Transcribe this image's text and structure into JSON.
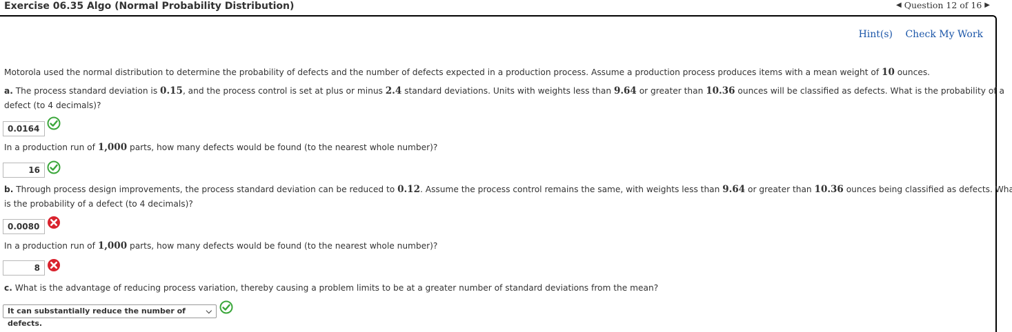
{
  "header": {
    "title": "Exercise 06.35 Algo (Normal Probability Distribution)",
    "question_nav": "Question 12 of 16"
  },
  "links": {
    "hints": "Hint(s)",
    "check": "Check My Work"
  },
  "intro": {
    "t1": "Motorola used the normal distribution to determine the probability of defects and the number of defects expected in a production process. Assume a production process produces items with a mean weight of ",
    "mean": "10",
    "t2": " ounces."
  },
  "part_a": {
    "letter": "a.",
    "t1": " The process standard deviation is ",
    "sd": "0.15",
    "t2": ", and the process control is set at plus or minus ",
    "k": "2.4",
    "t3": " standard deviations. Units with weights less than ",
    "low": "9.64",
    "t4": " or greater than ",
    "high": "10.36",
    "t5": " ounces will be classified as defects. What is the probability of a",
    "line2": "defect (to 4 decimals)?",
    "answer": "0.0164",
    "answer_status": "correct"
  },
  "part_a2": {
    "t1": "In a production run of ",
    "n": "1,000",
    "t2": " parts, how many defects would be found (to the nearest whole number)?",
    "answer": "16",
    "answer_status": "correct"
  },
  "part_b": {
    "letter": "b.",
    "t1": " Through process design improvements, the process standard deviation can be reduced to ",
    "sd": "0.12",
    "t2": ". Assume the process control remains the same, with weights less than ",
    "low": "9.64",
    "t3": " or greater than ",
    "high": "10.36",
    "t4": " ounces being classified as defects. What",
    "line2": "is the probability of a defect (to 4 decimals)?",
    "answer": "0.0080",
    "answer_status": "incorrect"
  },
  "part_b2": {
    "t1": "In a production run of ",
    "n": "1,000",
    "t2": " parts, how many defects would be found (to the nearest whole number)?",
    "answer": "8",
    "answer_status": "incorrect"
  },
  "part_c": {
    "letter": "c.",
    "t1": " What is the advantage of reducing process variation, thereby causing a problem limits to be at a greater number of standard deviations from the mean?",
    "selected": "It can substantially reduce the number of defects.",
    "answer_status": "correct"
  },
  "colors": {
    "link": "#1a55a8",
    "correct": "#3aa63a",
    "incorrect": "#d9232e"
  }
}
